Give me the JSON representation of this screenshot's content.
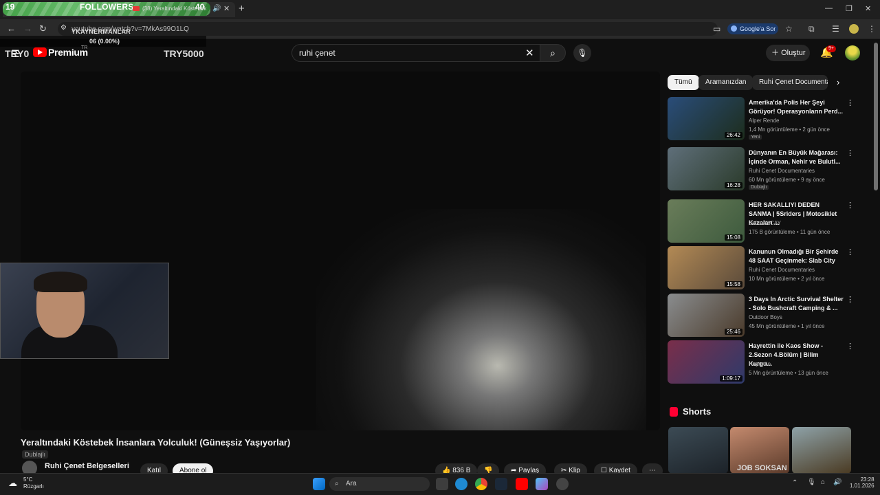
{
  "browser": {
    "followers_left": "19",
    "followers_label": "FOLLOWERS",
    "followers_right": "40",
    "tab_title": "(38) Yeraltındaki Köstebek",
    "url": "youtube.com/watch?v=7MkAs99O1LQ",
    "overlay_line1": "YKAYNERMANLAR",
    "overlay_line2": "06 (0.00%)",
    "google_button": "Google'a Sor"
  },
  "youtube": {
    "try_left": "TRY0",
    "try_right": "TRY5000",
    "logo_text": "Premium",
    "region": "TR",
    "search_value": "ruhi çenet",
    "create_label": "Oluştur",
    "notif_count": "9+",
    "video_title": "Yeraltındaki Köstebek İnsanlara Yolculuk! (Güneşsiz Yaşıyorlar)",
    "dubbed_label": "Dublajlı",
    "channel_name": "Ruhi Çenet Belgeselleri",
    "join_label": "Katıl",
    "subscribe_label": "Abone ol",
    "likes": "836 B",
    "share_label": "Paylaş",
    "clip_label": "Klip",
    "save_label": "Kaydet",
    "chips": [
      "Tümü",
      "Aramanızdan",
      "Ruhi Çenet Documentar"
    ],
    "shorts_label": "Shorts",
    "recommendations": [
      {
        "title": "Amerika'da Polis Her Şeyi Görüyor! Operasyonların Perd...",
        "channel": "Alper Rende",
        "meta": "1,4 Mn görüntüleme • 2 gün önce",
        "duration": "26:42",
        "badge": "Yeni",
        "color1": "#2a4d7a",
        "color2": "#1d2d1c"
      },
      {
        "title": "Dünyanın En Büyük Mağarası: İçinde Orman, Nehir ve Bulutl...",
        "channel": "Ruhi Cenet Documentaries",
        "meta": "60 Mn görüntüleme • 9 ay önce",
        "duration": "16:28",
        "badge": "Dublajlı",
        "color1": "#5f6f7a",
        "color2": "#2a3a2a"
      },
      {
        "title": "HER SAKALLIYI DEDEN SANMA | 5Sriders | Motosiklet Kazaları ...",
        "channel": "Zafer AKCAY",
        "meta": "175 B görüntüleme • 11 gün önce",
        "duration": "15:08",
        "badge": "",
        "color1": "#6a7d5a",
        "color2": "#3d5a3d"
      },
      {
        "title": "Kanunun Olmadığı Bir Şehirde 48 SAAT Geçinmek: Slab City",
        "channel": "Ruhi Cenet Documentaries",
        "meta": "10 Mn görüntüleme • 2 yıl önce",
        "duration": "15:58",
        "badge": "",
        "color1": "#b38a55",
        "color2": "#5a4a3a"
      },
      {
        "title": "3 Days In Arctic Survival Shelter - Solo Bushcraft Camping & ...",
        "channel": "Outdoor Boys",
        "meta": "45 Mn görüntüleme • 1 yıl önce",
        "duration": "25:46",
        "badge": "",
        "color1": "#8a8d8f",
        "color2": "#4a3a2a"
      },
      {
        "title": "Hayrettin ile Kaos Show - 2.Sezon 4.Bölüm | Bilim Kurgu...",
        "channel": "Hayrettin",
        "meta": "5 Mn görüntüleme • 13 gün önce",
        "duration": "1:09:17",
        "badge": "",
        "color1": "#7a2e4a",
        "color2": "#2e3a6a"
      }
    ],
    "shorts": [
      {
        "color1": "#3c4b55",
        "color2": "#1c2228"
      },
      {
        "color1": "#c48a6e",
        "color2": "#5a3a2a",
        "text": "JOB SOKSAN"
      },
      {
        "color1": "#8ea2a8",
        "color2": "#4a3a22"
      }
    ]
  },
  "taskbar": {
    "temperature": "5°C",
    "weather": "Rüzgarlı",
    "search_placeholder": "Ara",
    "time": "23:28",
    "date": "1.01.2026"
  }
}
